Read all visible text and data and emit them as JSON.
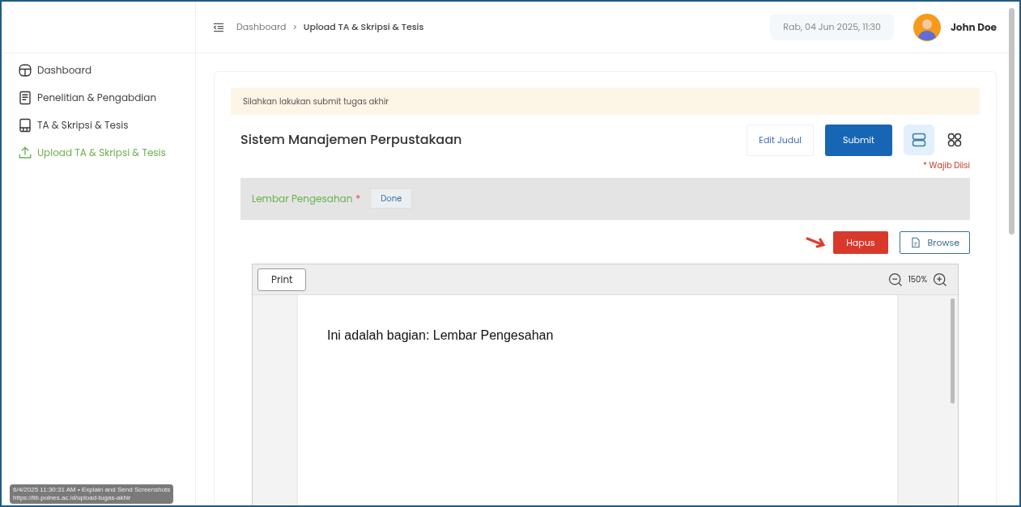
{
  "header": {
    "breadcrumb": [
      "Dashboard",
      "Upload TA & Skripsi & Tesis"
    ],
    "breadcrumb_separator": ">",
    "datetime": "Rab, 04 Jun 2025, 11:30",
    "user_name": "John Doe"
  },
  "sidebar": {
    "items": [
      {
        "label": "Dashboard",
        "kind": "dashboard",
        "selected": false
      },
      {
        "label": "Penelitian & Pengabdian",
        "kind": "research",
        "selected": false
      },
      {
        "label": "TA & Skripsi & Tesis",
        "kind": "thesis",
        "selected": false
      },
      {
        "label": "Upload TA & Skripsi & Tesis",
        "kind": "upload",
        "selected": true
      }
    ]
  },
  "alert": "Silahkan lakukan submit tugas akhir",
  "title": "Sistem Manajemen Perpustakaan",
  "actions": {
    "edit": "Edit Judul",
    "submit": "Submit"
  },
  "views": [
    {
      "kind": "list",
      "selected": true
    },
    {
      "kind": "grid",
      "selected": false
    }
  ],
  "required_note": "* Wajib Diisi",
  "section": {
    "label": "Lembar Pengesahan",
    "required_mark": "*",
    "status": "Done"
  },
  "file_actions": {
    "delete": "Hapus",
    "browse": "Browse"
  },
  "viewer": {
    "print": "Print",
    "zoom": "150%",
    "page_text": "Ini adalah bagian: Lembar Pengesahan"
  },
  "capture_overlay": [
    "6/4/2025 11:30:31 AM • Explain and Send Screenshots",
    "https://lib.polnes.ac.id/upload-tugas-akhir"
  ]
}
